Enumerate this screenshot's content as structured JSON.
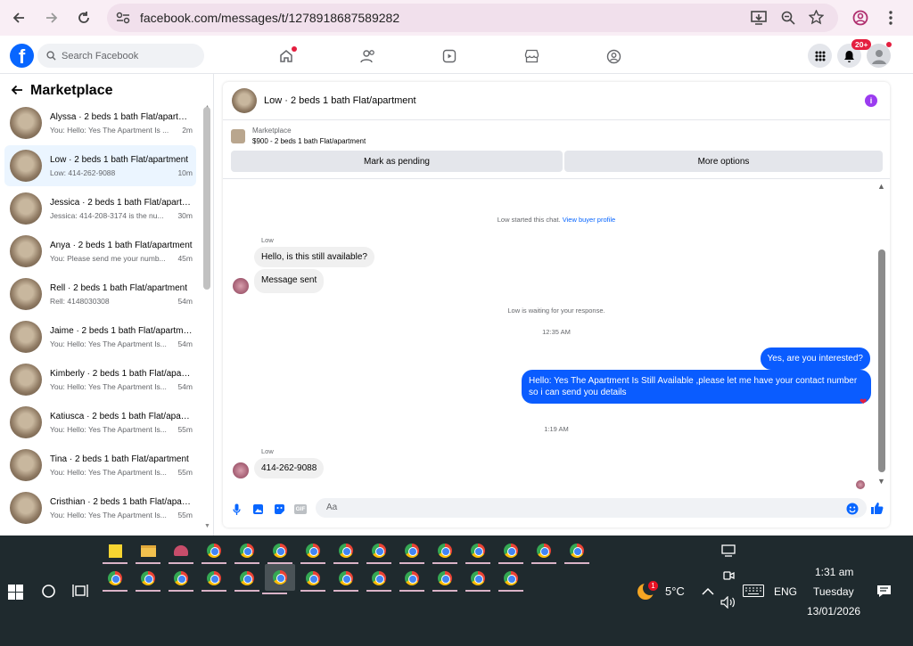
{
  "browser": {
    "url": "facebook.com/messages/t/1278918687589282"
  },
  "facebook": {
    "search_placeholder": "Search Facebook",
    "notif_badge": "20+"
  },
  "sidebar": {
    "title": "Marketplace",
    "conversations": [
      {
        "name": "Alyssa · 2 beds 1 bath Flat/apartment",
        "snippet": "You: Hello: Yes The Apartment Is ...",
        "time": "2m",
        "active": false
      },
      {
        "name": "Low · 2 beds 1 bath Flat/apartment",
        "snippet": "Low: 414-262-9088",
        "time": "10m",
        "active": true
      },
      {
        "name": "Jessica · 2 beds 1 bath Flat/apartment",
        "snippet": "Jessica: 414-208-3174 is the nu...",
        "time": "30m",
        "active": false
      },
      {
        "name": "Anya · 2 beds 1 bath Flat/apartment",
        "snippet": "You: Please send me your numb...",
        "time": "45m",
        "active": false
      },
      {
        "name": "Rell · 2 beds 1 bath Flat/apartment",
        "snippet": "Rell: 4148030308",
        "time": "54m",
        "active": false
      },
      {
        "name": "Jaime · 2 beds 1 bath Flat/apartment",
        "snippet": "You: Hello: Yes The Apartment Is...",
        "time": "54m",
        "active": false
      },
      {
        "name": "Kimberly · 2 beds 1 bath Flat/apartment",
        "snippet": "You: Hello: Yes The Apartment Is...",
        "time": "54m",
        "active": false
      },
      {
        "name": "Katiusca · 2 beds 1 bath Flat/apartment",
        "snippet": "You: Hello: Yes The Apartment Is...",
        "time": "55m",
        "active": false
      },
      {
        "name": "Tina · 2 beds 1 bath Flat/apartment",
        "snippet": "You: Hello: Yes The Apartment Is...",
        "time": "55m",
        "active": false
      },
      {
        "name": "Cristhian · 2 beds 1 bath Flat/apartment",
        "snippet": "You: Hello: Yes The Apartment Is...",
        "time": "55m",
        "active": false
      }
    ]
  },
  "chat": {
    "title": "Low · 2 beds 1 bath Flat/apartment",
    "marketplace_label": "Marketplace",
    "listing": "$900 - 2 beds 1 bath Flat/apartment",
    "mark_pending": "Mark as pending",
    "more_options": "More options",
    "started_text": "Low started this chat.",
    "view_profile": "View buyer profile",
    "sender_label_1": "Low",
    "msg_in_1": "Hello, is this still available?",
    "msg_in_2": "Message sent",
    "waiting_text": "Low is waiting for your response.",
    "time_1": "12:35 AM",
    "msg_out_1": "Yes, are you interested?",
    "msg_out_2": "Hello: Yes The Apartment Is Still Available ,please let me have your contact number so i can send you details",
    "time_2": "1:19 AM",
    "sender_label_2": "Low",
    "msg_in_3": "414-262-9088",
    "composer_placeholder": "Aa"
  },
  "taskbar": {
    "weather_badge": "1",
    "temperature": "5°C",
    "language": "ENG",
    "time": "1:31 am",
    "day": "Tuesday",
    "date": "13/01/2026"
  }
}
